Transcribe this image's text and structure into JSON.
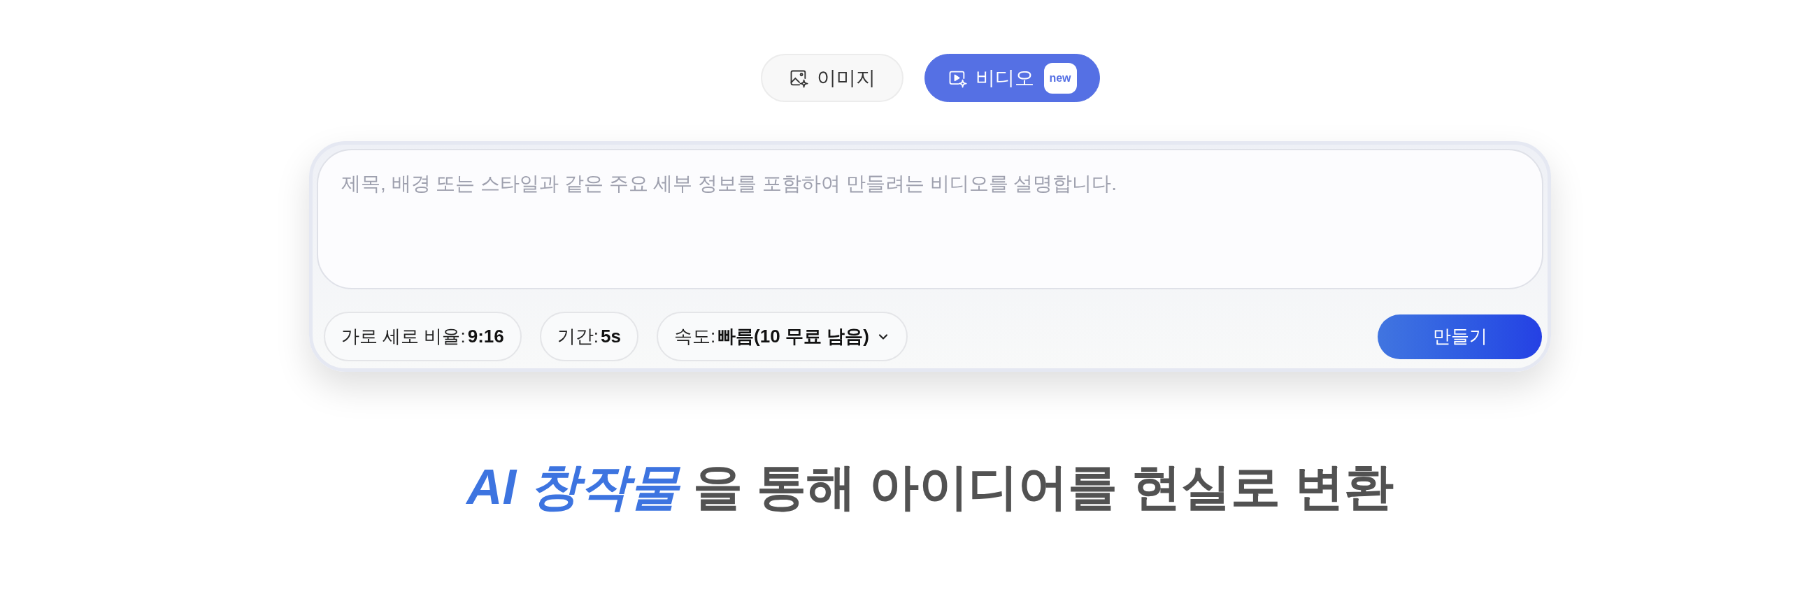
{
  "mode_tabs": [
    {
      "kind": "image",
      "label": "이미지",
      "selected": false
    },
    {
      "kind": "video",
      "label": "비디오",
      "selected": true,
      "badge": "new"
    }
  ],
  "prompt": {
    "placeholder": "제목, 배경 또는 스타일과 같은 주요 세부 정보를 포함하여 만들려는 비디오를 설명합니다."
  },
  "options": [
    {
      "label": "가로 세로 비율:",
      "value": "9:16",
      "dropdown": false
    },
    {
      "label": "기간:",
      "value": "5s",
      "dropdown": false
    },
    {
      "label": "속도:",
      "value": "빠름(10 무료 남음)",
      "dropdown": true
    }
  ],
  "create_button": "만들기",
  "headline": {
    "highlight": "AI 창작물",
    "text": "을 통해 아이디어를 현실로 변환"
  }
}
